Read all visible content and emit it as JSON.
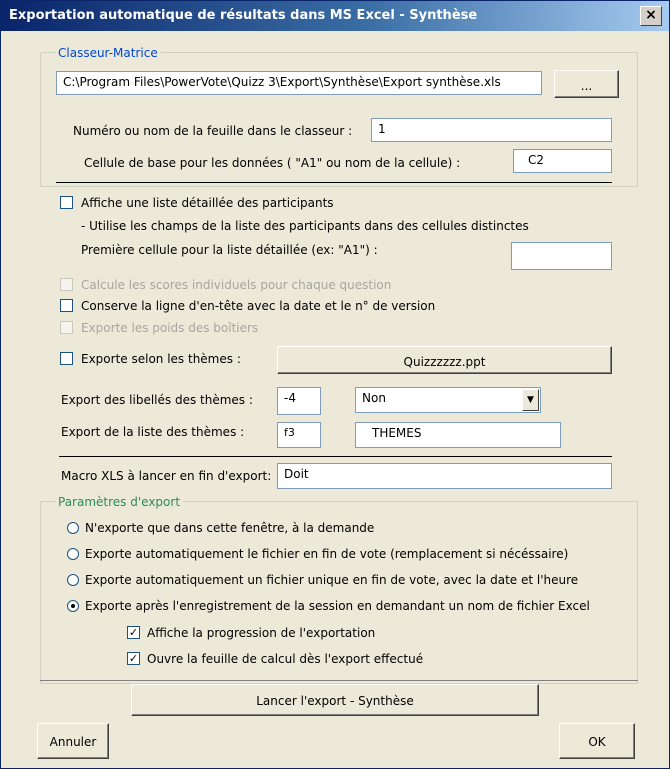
{
  "window": {
    "title": "Exportation automatique de résultats dans MS Excel - Synthèse",
    "close_label": "×"
  },
  "workbook_group": {
    "title": "Classeur-Matrice",
    "path_value": "C:\\Program Files\\PowerVote\\Quizz 3\\Export\\Synthèse\\Export synthèse.xls",
    "browse_label": "...",
    "sheet_label": "Numéro ou nom de la feuille dans le classeur :",
    "sheet_value": "1",
    "base_cell_label": "Cellule de base pour les données ( \"A1\" ou nom de la cellule) :",
    "base_cell_value": "C2"
  },
  "options": {
    "detailed_list_label": "Affiche une liste détaillée des participants",
    "detailed_list_note": "- Utilise les champs de la liste des participants dans des cellules distinctes",
    "first_cell_label": "Première cellule pour la liste détaillée (ex: \"A1\") :",
    "first_cell_value": "",
    "scores_label": "Calcule les scores individuels pour chaque question",
    "header_line_label": "Conserve la ligne d'en-tête avec la date et le n° de version",
    "weights_label": "Exporte les poids des boîtiers",
    "themes_label": "Exporte selon les thèmes :",
    "themes_file_label": "Quizzzzzz.ppt",
    "theme_labels_label": "Export des libellés des thèmes :",
    "theme_labels_cell": "-4",
    "theme_labels_select": "Non",
    "theme_list_label": "Export de la liste des thèmes :",
    "theme_list_cell": "f3",
    "theme_list_value": "THEMES",
    "macro_label": "Macro XLS à lancer en fin d'export:",
    "macro_value": "Doit"
  },
  "export_params": {
    "title": "Paramètres d'export",
    "radios": [
      "N'exporte que dans cette fenêtre, à la demande",
      "Exporte automatiquement le fichier en fin de vote (remplacement si nécéssaire)",
      "Exporte automatiquement un fichier unique en fin de vote, avec la date et l'heure",
      "Exporte après l'enregistrement de la session en demandant un nom de fichier Excel"
    ],
    "progress_label": "Affiche la progression de l'exportation",
    "open_sheet_label": "Ouvre la feuille de calcul dès l'export effectué"
  },
  "footer": {
    "launch_label": "Lancer l'export - Synthèse",
    "cancel_label": "Annuler",
    "ok_label": "OK"
  },
  "colors": {
    "title_bar_start": "#0a246a",
    "title_bar_end": "#a6caf0",
    "dialog_bg": "#ece9d8",
    "group_title_blue": "#0046d5",
    "group_title_green": "#2e8b57"
  }
}
